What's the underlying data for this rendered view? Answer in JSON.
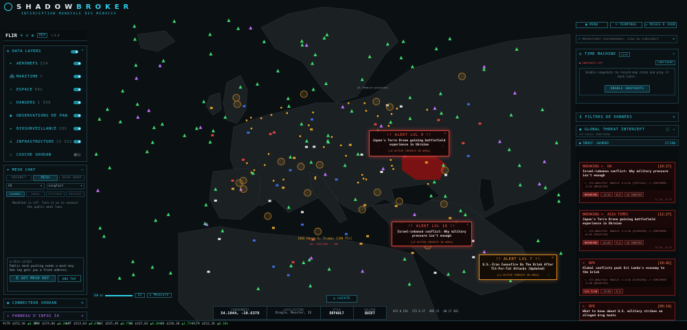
{
  "app": {
    "title": "SHADOWBROKER",
    "title_colored": [
      "SHADOW",
      "BROKER"
    ],
    "subtitle": "INTERCEPTION MONDIALE DES MENACES",
    "mode": "FLIR",
    "sub_a": "HEX",
    "sub_b": "1.0.0"
  },
  "top_buttons": {
    "menu": "MENU",
    "terminal": "TERMINAL",
    "updates": "MISES À JOUR"
  },
  "search": {
    "placeholder": "Rechercher coordonnées, lieu ou indicatif"
  },
  "left": {
    "data_layers": "DATA LAYERS",
    "layers": [
      {
        "label": "AÉRONEFS",
        "count": "314",
        "icon": "plane-icon",
        "on": true
      },
      {
        "label": "MARITIME",
        "count": "7",
        "icon": "ship-icon",
        "on": true
      },
      {
        "label": "ESPACE",
        "count": "492",
        "icon": "satellite-icon",
        "on": true
      },
      {
        "label": "DANGERS",
        "count": "1 399",
        "icon": "hazard-icon",
        "on": true
      },
      {
        "label": "OBSERVATIONS DE PAN",
        "count": "",
        "icon": "eye-icon",
        "on": true
      },
      {
        "label": "BIOSURVEILLANCE",
        "count": "291",
        "icon": "bio-icon",
        "on": true
      },
      {
        "label": "INFRASTRUCTURE",
        "count": "13 932",
        "icon": "tower-icon",
        "on": true
      },
      {
        "label": "COUCHE SHODAN",
        "count": "",
        "icon": "shodan-icon",
        "on": false
      }
    ],
    "mesh": {
      "title": "MESH CHAT",
      "tabs": [
        "INFONET",
        "MESH",
        "DEAD DROP"
      ],
      "region": "US",
      "preset": "LongFast",
      "subtabs": [
        "CHANNEL",
        "INBOX",
        "SETTINGS",
        "MESSAGE"
      ],
      "off_text": "MeshChat is off. Turn it on to connect the public mesh lane.",
      "locked_title": "MESH LOCKED",
      "locked_text": "Public mesh posting needs a mesh key. One tap gets you a fresh address.",
      "get_key": "GET MESH KEY",
      "one_tap": "ONE TAP"
    },
    "shodan": "CONNECTEUR SHODAN",
    "ai": "PANNEAU D'INFOS IA"
  },
  "right": {
    "time_machine": "TIME MACHINE",
    "live": "LIVE",
    "snapshots_off": "SNAPSHOTS OFF",
    "configure": "CONFIGURE",
    "snap_text": "Enable snapshots to record map state and play it back later.",
    "enable": "ENABLE SNAPSHOTS",
    "filters": "FILTRES DE DONNÉES",
    "gti": "GLOBAL THREAT INTERCEPT",
    "gti_sub": "SYS STATUS: MONITORING",
    "threat": "THREAT: GUARDED",
    "threat_count": "27/100",
    "news": [
      {
        "tag": "BREAKING",
        "src": "DW",
        "time": "[10:17]",
        "title": "Israel-Lebanon conflict: Why military pressure isn't enough",
        "ana": ">_ SYS.ANALYSIS: ORACLE: 8.6/10 [CRITICAL] // SENTIMENT: -0.54 [NEGATIVE]",
        "chips": [
          "BREAKING",
          "-0.54",
          "8.6",
          "+6 SOURCES"
        ],
        "stamp": "31.5N, 35.2E"
      },
      {
        "tag": "BREAKING",
        "src": "ASIA TIMES",
        "time": "[12:27]",
        "title": "Japan's Terra Drone gaining battlefield experience in Ukraine",
        "ana": ">_ SYS.ANALYSIS: ORACLE: 5.4/10 [ELEVATED] // SENTIMENT: +0.05 [POSITIVE]",
        "chips": [
          "BREAKING",
          "+0.05",
          "5.4",
          "+6 SOURCES"
        ],
        "stamp": "50.4N, 30.5E"
      },
      {
        "tag": "",
        "src": "NPR",
        "time": "[10:42]",
        "title": "Global conflicts push Sri Lanka's economy to the brink",
        "ana": ">_ SYS.ANALYSIS: ORACLE: 5.4/10 [ELEVATED] // SENTIMENT: -0.58 [NEGATIVE]",
        "chips": [
          "LVL 7/10",
          "-0.58",
          "5.4"
        ],
        "stamp": ""
      },
      {
        "tag": "",
        "src": "NPR",
        "time": "[09:14]",
        "title": "What to know about U.S. military strikes on alleged drug boats",
        "ana": "",
        "chips": [],
        "stamp": ""
      }
    ]
  },
  "alerts": [
    {
      "title": "!! ALERT LVL 9 !!",
      "body": "Japan's Terra Drone gaining battlefield experience in Ukraine",
      "foot": "[+6 ACTIVE THREATS IN AREA]"
    },
    {
      "title": "!! ALERT LVL 10 !!",
      "body": "Israel-Lebanon conflict: Why military pressure isn't enough",
      "foot": "[+6 ACTIVE THREATS IN AREA]"
    },
    {
      "title": "!! ALERT LVL 7 !!",
      "body": "U.S.-Iran Ceasefire On The Brink After Tit-For-Tat Attacks (Updated)",
      "foot": "[+1 ACTIVE THREATS IN AREA]"
    }
  ],
  "ship_label": "[USS Harry S. Truman (CVN-75)]",
  "ship_sub": "LOC: POSITION -- USN",
  "map_label": "LR (Mobile position)",
  "bottom": {
    "coords_label": "COORDONNÉES",
    "coords": "54.1044, -10.6378",
    "loc_label": "LOCALISATION",
    "loc": "Dingle, Munster, IE",
    "style_label": "STYLE",
    "style": "DEFAULT",
    "solar_label": "SOLAIRE",
    "solar": "QUIET",
    "stats": [
      "AFS 0 154",
      "ITS 0 17",
      "AMS 15",
      "AN 17 492"
    ],
    "locate": "LOCATE",
    "scale": "160 mi",
    "zoom": "Z2",
    "measure": "Measure"
  },
  "ticker": [
    {
      "sym": "PLTR",
      "price": "$152,36",
      "chg": "0.18%",
      "dir": "up"
    },
    {
      "sym": "RTX",
      "price": "$174,06",
      "chg": "0.20%",
      "dir": "up"
    },
    {
      "sym": "LMT",
      "price": "$513,64",
      "chg": "0.67%",
      "dir": "up"
    },
    {
      "sym": "NOC",
      "price": "$535,49",
      "chg": "0.77%",
      "dir": "up"
    },
    {
      "sym": "GD",
      "price": "$337,03",
      "chg": "0.30%",
      "dir": "up"
    },
    {
      "sym": "BA",
      "price": "$220,30",
      "chg": "1.75%",
      "dir": "up"
    },
    {
      "sym": "PLTR",
      "price": "$152,36",
      "chg": "0.18%",
      "dir": "up"
    }
  ],
  "colors": {
    "accent": "#2fd0e8",
    "alert": "#e0443c",
    "land": "#1a1f22",
    "sea": "#0b1013",
    "hazard": "#3fdc6a"
  }
}
